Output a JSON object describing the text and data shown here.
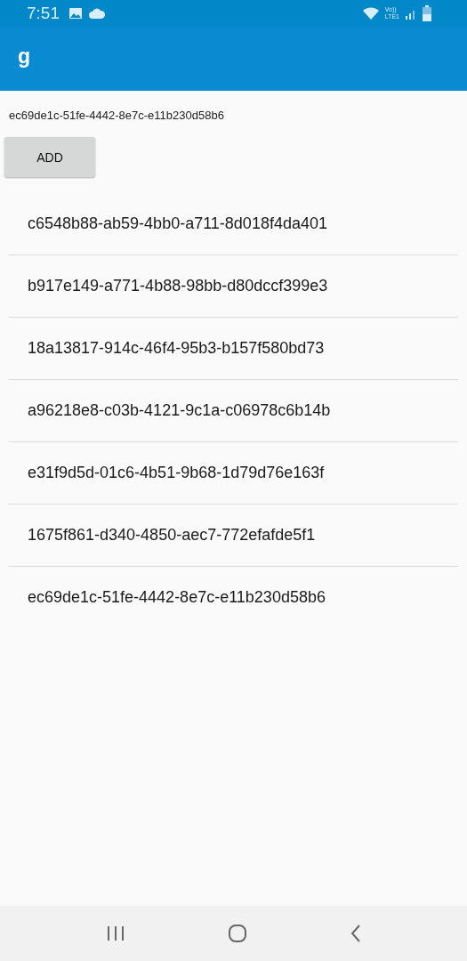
{
  "status_bar": {
    "time": "7:51",
    "voice": "Vo))",
    "network": "LTE1"
  },
  "app_bar": {
    "title": "g"
  },
  "current_id": "ec69de1c-51fe-4442-8e7c-e11b230d58b6",
  "add_button": "ADD",
  "items": [
    "c6548b88-ab59-4bb0-a711-8d018f4da401",
    "b917e149-a771-4b88-98bb-d80dccf399e3",
    "18a13817-914c-46f4-95b3-b157f580bd73",
    "a96218e8-c03b-4121-9c1a-c06978c6b14b",
    "e31f9d5d-01c6-4b51-9b68-1d79d76e163f",
    "1675f861-d340-4850-aec7-772efafde5f1",
    "ec69de1c-51fe-4442-8e7c-e11b230d58b6"
  ]
}
